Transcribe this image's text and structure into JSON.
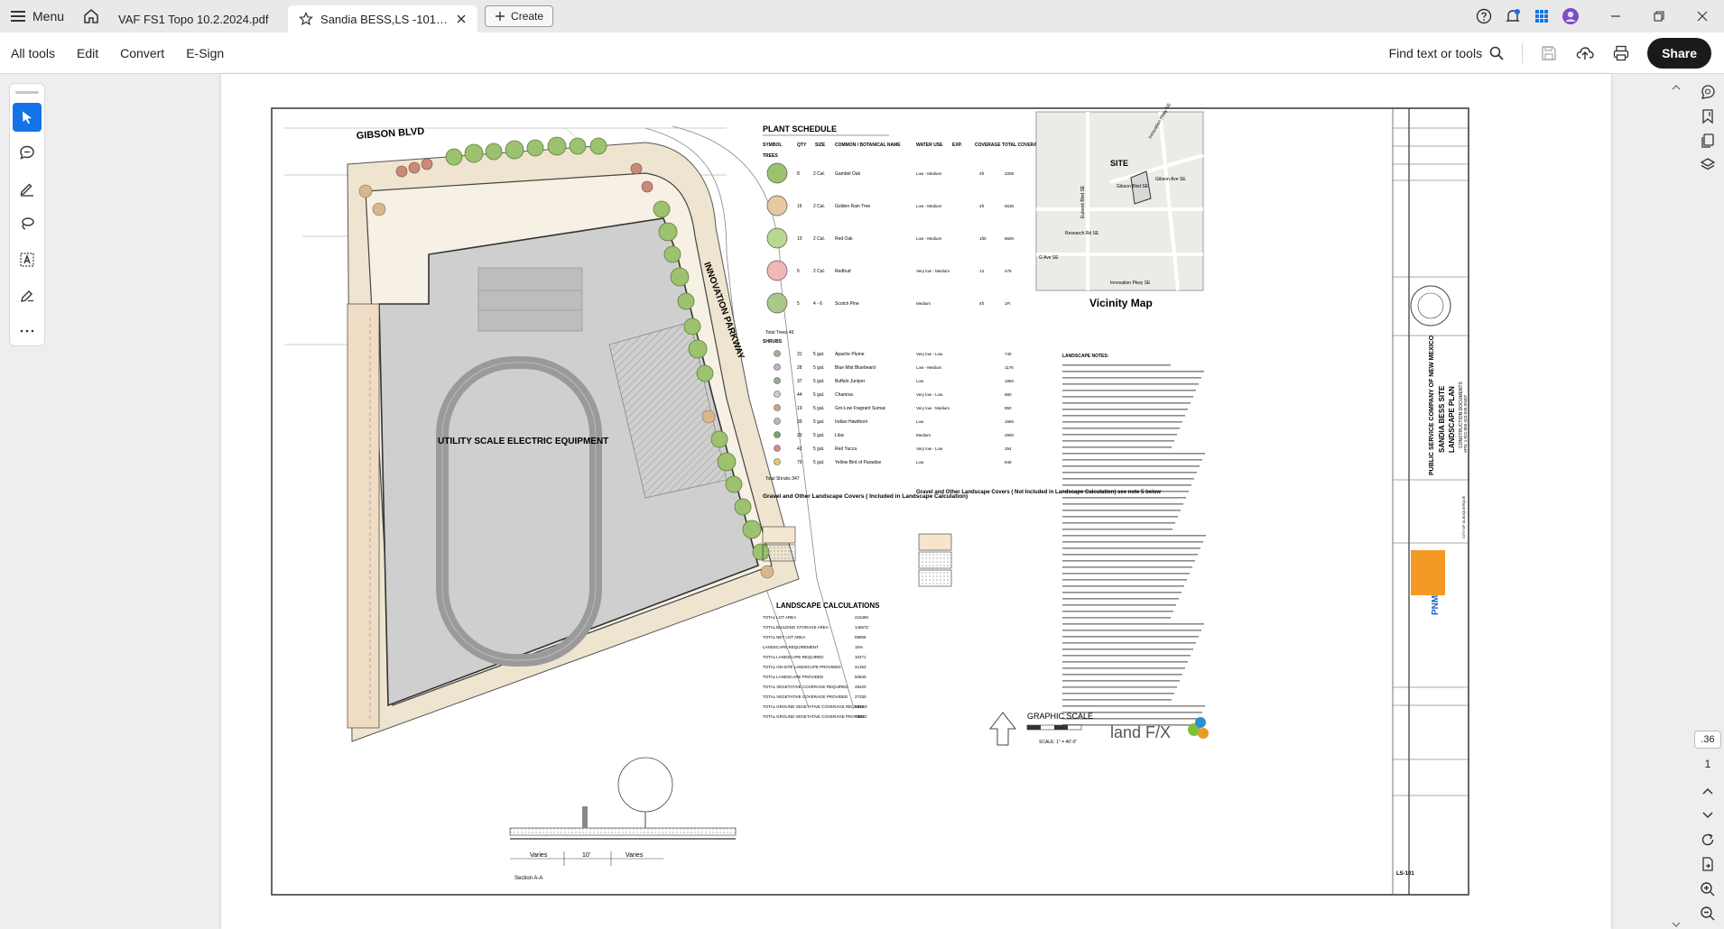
{
  "titlebar": {
    "menu_label": "Menu",
    "tabs": [
      {
        "label": "VAF FS1 Topo 10.2.2024.pdf"
      },
      {
        "label": "Sandia BESS,LS -101r col..."
      }
    ],
    "create_label": "Create"
  },
  "toolbar": {
    "menu": [
      "All tools",
      "Edit",
      "Convert",
      "E-Sign"
    ],
    "find_label": "Find text or tools",
    "share_label": "Share"
  },
  "pager": {
    "current": ".36",
    "total": "1"
  },
  "drawing": {
    "plan": {
      "gibson_blvd": "GIBSON BLVD",
      "innovation_parkway": "INNOVATION PARKWAY",
      "equipment_label": "UTILITY SCALE ELECTRIC EQUIPMENT",
      "section_labels": [
        "Varies",
        "10'",
        "Varies"
      ],
      "section_title": "Section A-A"
    },
    "plant_schedule": {
      "title": "PLANT SCHEDULE",
      "headers": [
        "SYMBOL",
        "QTY",
        "SIZE",
        "COMMON / BOTANICAL NAME",
        "WATER USE",
        "EXP.",
        "COVERAGE",
        "TOTAL COVERAGE"
      ],
      "trees_label": "TREES",
      "shrubs_label": "SHRUBS",
      "trees": [
        {
          "qty": "8",
          "size": "2 Cal.",
          "name": "Gambel Oak",
          "water": "Low - Medium",
          "cov": "4ft",
          "total": "3308"
        },
        {
          "qty": "16",
          "size": "2 Cal.",
          "name": "Golden Rain Tree",
          "water": "Low - Medium",
          "cov": "4ft",
          "total": "5536"
        },
        {
          "qty": "10",
          "size": "2 Cal.",
          "name": "Red Oak",
          "water": "Low - Medium",
          "cov": "1ft0",
          "total": "5600"
        },
        {
          "qty": "6",
          "size": "2 Cal.",
          "name": "Redbud",
          "water": "Very low - Medium",
          "cov": "13",
          "total": "478"
        },
        {
          "qty": "5",
          "size": "4 - 6",
          "name": "Scotch Pine",
          "water": "Medium",
          "cov": "4ft",
          "total": "1Ft"
        }
      ],
      "tree_total": "Total Trees  45",
      "shrubs": [
        {
          "qty": "31",
          "size": "5 gal.",
          "name": "Apache Plume",
          "water": "Very low - Low",
          "total": "740"
        },
        {
          "qty": "28",
          "size": "5 gal.",
          "name": "Blue Mist Bluebeard",
          "water": "Low - Medium",
          "total": "1176"
        },
        {
          "qty": "37",
          "size": "5 gal.",
          "name": "Buffalo Juniper",
          "water": "Low",
          "total": "1850"
        },
        {
          "qty": "44",
          "size": "5 gal.",
          "name": "Chamisa",
          "water": "Very low - Low",
          "total": "880"
        },
        {
          "qty": "19",
          "size": "5 gal.",
          "name": "Gro-Low Fragrant Sumac",
          "water": "Very low - Medium",
          "total": "950"
        },
        {
          "qty": "39",
          "size": "5 gal.",
          "name": "Indian Hawthorn",
          "water": "Low",
          "total": "1560"
        },
        {
          "qty": "29",
          "size": "5 gal.",
          "name": "Lilac",
          "water": "Medium",
          "total": "2900"
        },
        {
          "qty": "42",
          "size": "5 gal.",
          "name": "Red Yucca",
          "water": "Very low - Low",
          "total": "294"
        },
        {
          "qty": "79",
          "size": "5 gal.",
          "name": "Yellow Bird of Paradise",
          "water": "Low",
          "total": "948"
        }
      ],
      "shrub_total": "Total Shrubs  347"
    },
    "vicinity": {
      "title": "Vicinity Map",
      "site": "SITE",
      "streets": [
        "Innovation Pkwy SE",
        "Gibson Blvd SE",
        "Gibson Ave SE",
        "Research Rd SE",
        "G Ave SE",
        "Innovation Pkwy SE",
        "Eubank Blvd SE"
      ]
    },
    "gravel_included": {
      "title": "Gravel and Other Landscape Covers ( Included in Landscape Calculation)"
    },
    "gravel_excluded": {
      "title": "Gravel and Other Landscape Covers ( Not Included in Landscape Calculation) see note 5 below"
    },
    "calculations": {
      "title": "LANDSCAPE CALCULATIONS",
      "rows": [
        {
          "label": "TOTAL LOT AREA",
          "value": "215480"
        },
        {
          "label": "TOTAL BUILDING STORAGE AREA",
          "value": "145672"
        },
        {
          "label": "TOTAL NET LOT AREA",
          "value": "69808"
        },
        {
          "label": "LANDSCAPE REQUIREMENT",
          "value": "15%"
        },
        {
          "label": "TOTAL LANDSCAPE REQUIRED",
          "value": "10471"
        },
        {
          "label": "TOTAL ON-SITE LANDSCAPE PROVIDED",
          "value": "41353"
        },
        {
          "label": "TOTAL LANDSCAPE PROVIDED",
          "value": "50840"
        },
        {
          "label": "TOTAL VEGETATIVE COVERAGE REQUIRED",
          "value": "25420"
        },
        {
          "label": "TOTAL VEGETATIVE COVERAGE PROVIDED",
          "value": "27330"
        },
        {
          "label": "TOTAL GROUND VEGETATIVE COVERAGE REQUIRED",
          "value": "5316"
        },
        {
          "label": "TOTAL GROUND VEGETATIVE COVERAGE PROVIDED",
          "value": "7303"
        }
      ]
    },
    "notes_title": "LANDSCAPE NOTES:",
    "graphic_scale": "GRAPHIC SCALE",
    "scale_note": "SCALE: 1\" = 40'-0\"",
    "landfx": "land F/X",
    "titleblock": {
      "company": "PUBLIC SERVICE COMPANY OF NEW MEXICO",
      "project": "SANDIA BESS SITE",
      "sheet": "LANDSCAPE PLAN",
      "subtitle": "CONSTRUCTION DOCUMENTS",
      "apn": "APN: 1-021-055-423-035-20407",
      "city": "CITY OF ALBUQUERQUE",
      "logo": "PNM",
      "sheet_no": "LS-101"
    }
  }
}
